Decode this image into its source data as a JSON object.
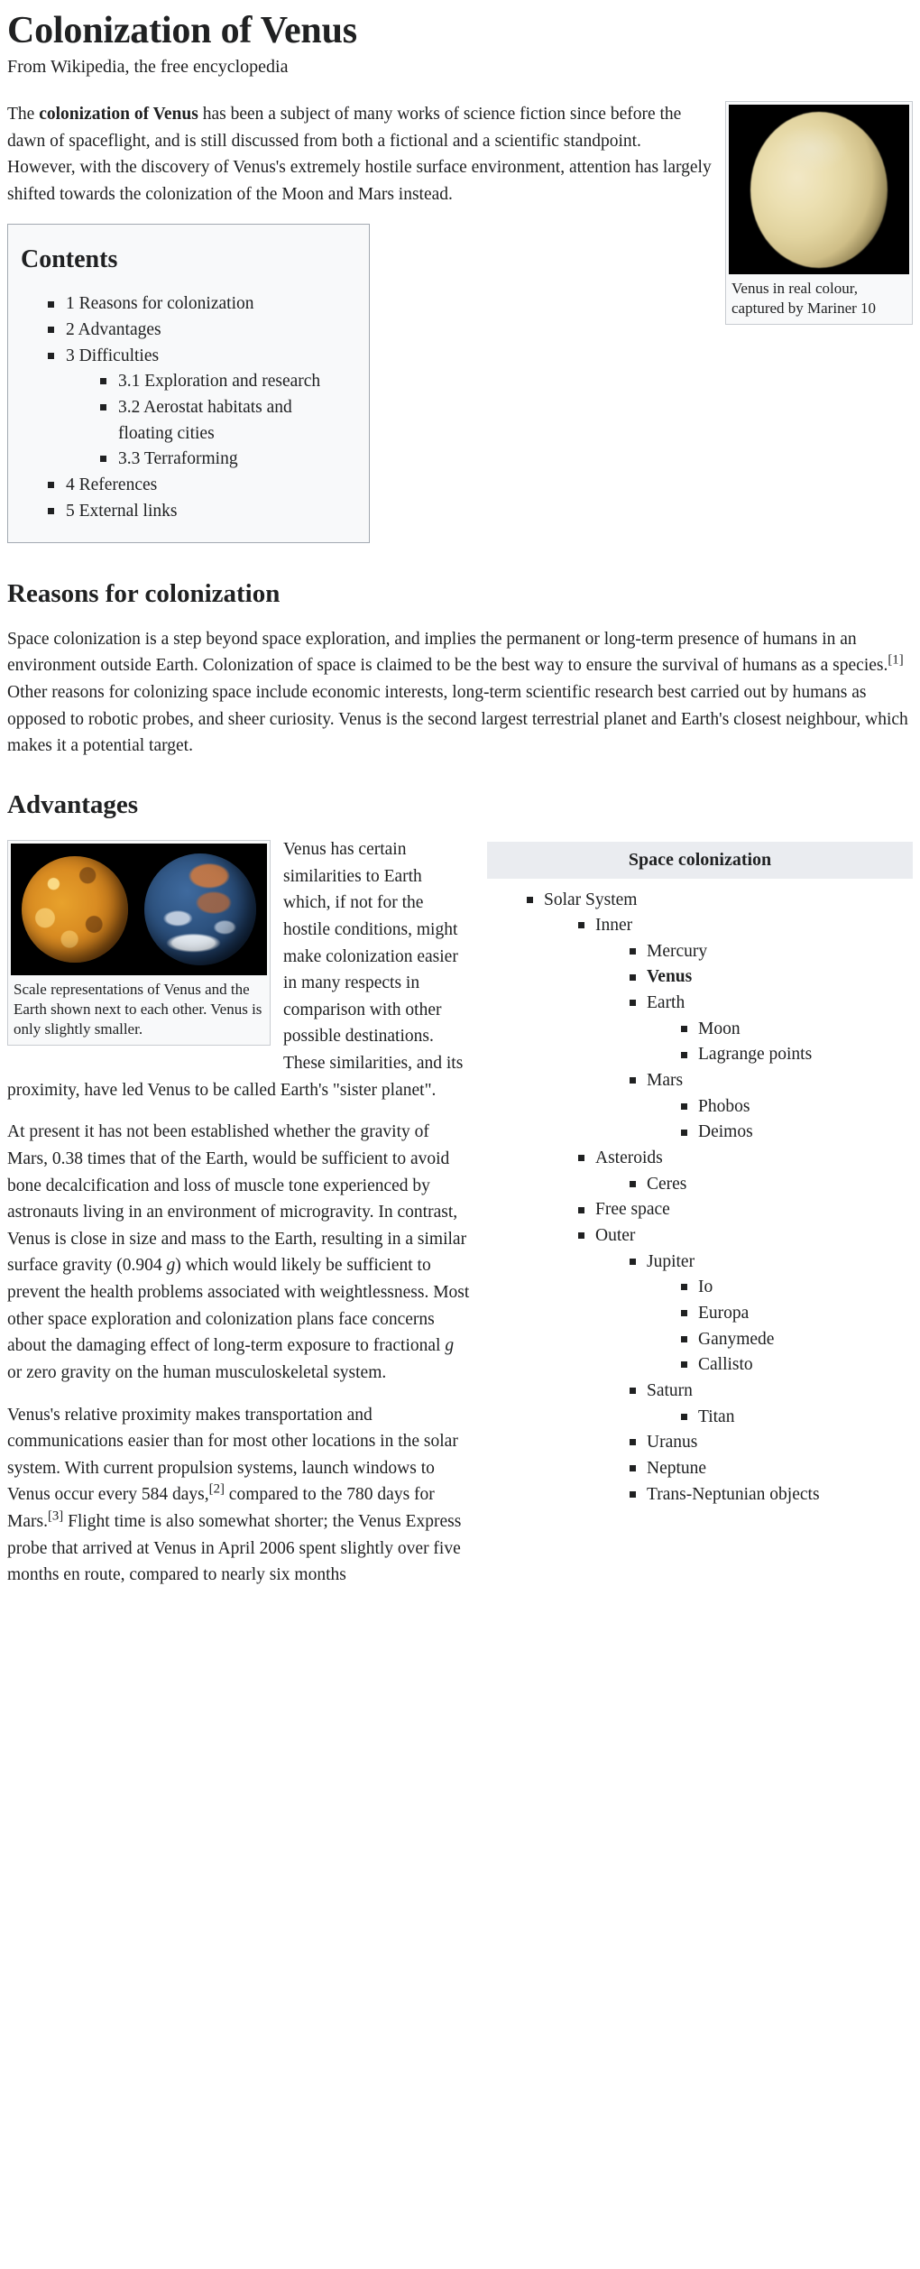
{
  "article": {
    "title": "Colonization of Venus",
    "tagline": "From Wikipedia, the free encyclopedia"
  },
  "lead": {
    "p1_before_bold": "The ",
    "p1_bold": "colonization of Venus",
    "p1_after_bold": " has been a subject of many works of science fiction since before the dawn of spaceflight, and is still discussed from both a fictional and a scientific standpoint. However, with the discovery of Venus's extremely hostile surface environment, attention has largely shifted towards the colonization of the Moon and Mars instead."
  },
  "figures": {
    "venus_real": {
      "caption": "Venus in real colour, captured by Mariner 10",
      "alt": "Venus in real colour",
      "background_color": "#000000",
      "planet_color": "#e2d4a0"
    },
    "venus_earth_scale": {
      "caption": "Scale representations of Venus and the Earth shown next to each other. Venus is only slightly smaller.",
      "alt": "Venus and Earth side by side",
      "background_color": "#000000",
      "venus_color": "#d98c22",
      "earth_color": "#2d527f"
    }
  },
  "toc": {
    "heading": "Contents",
    "items": [
      {
        "label": "1 Reasons for colonization",
        "children": []
      },
      {
        "label": "2 Advantages",
        "children": []
      },
      {
        "label": "3 Difficulties",
        "children": [
          {
            "label": "3.1 Exploration and research"
          },
          {
            "label": "3.2 Aerostat habitats and floating cities"
          },
          {
            "label": "3.3 Terraforming"
          }
        ]
      },
      {
        "label": "4 References",
        "children": []
      },
      {
        "label": "5 External links",
        "children": []
      }
    ]
  },
  "sections": {
    "reasons": {
      "heading": "Reasons for colonization",
      "p1_a": "Space colonization is a step beyond space exploration, and implies the permanent or long-term presence of humans in an environment outside Earth. Colonization of space is claimed to be the best way to ensure the survival of humans as a species.",
      "p1_ref": "[1]",
      "p1_b": " Other reasons for colonizing space include economic interests, long-term scientific research best carried out by humans as opposed to robotic probes, and sheer curiosity. Venus is the second largest terrestrial planet and Earth's closest neighbour, which makes it a potential target."
    },
    "advantages": {
      "heading": "Advantages",
      "p1": "Venus has certain similarities to Earth which, if not for the hostile conditions, might make colonization easier in many respects in comparison with other possible destinations. These similarities, and its proximity, have led Venus to be called Earth's \"sister planet\".",
      "p2_a": "At present it has not been established whether the gravity of Mars, 0.38 times that of the Earth, would be sufficient to avoid bone decalcification and loss of muscle tone experienced by astronauts living in an environment of microgravity. In contrast, Venus is close in size and mass to the Earth, resulting in a similar surface gravity (0.904 ",
      "p2_italic_g": "g",
      "p2_b": ") which would likely be sufficient to prevent the health problems associated with weightlessness. Most other space exploration and colonization plans face concerns about the damaging effect of long-term exposure to fractional ",
      "p2_italic_g2": "g",
      "p2_c": " or zero gravity on the human musculoskeletal system.",
      "p3_a": "Venus's relative proximity makes transportation and communications easier than for most other locations in the solar system. With current propulsion systems, launch windows to Venus occur every 584 days,",
      "p3_ref2": "[2]",
      "p3_b": " compared to the 780 days for Mars.",
      "p3_ref3": "[3]",
      "p3_c": " Flight time is also somewhat shorter; the Venus Express probe that arrived at Venus in April 2006 spent slightly over five months en route, compared to nearly six months"
    }
  },
  "navbox": {
    "title": "Space colonization",
    "items": [
      {
        "label": "Solar System",
        "bold": false,
        "children": [
          {
            "label": "Inner",
            "bold": false,
            "children": [
              {
                "label": "Mercury",
                "bold": false,
                "children": []
              },
              {
                "label": "Venus",
                "bold": true,
                "children": []
              },
              {
                "label": "Earth",
                "bold": false,
                "children": [
                  {
                    "label": "Moon",
                    "bold": false,
                    "children": []
                  },
                  {
                    "label": "Lagrange points",
                    "bold": false,
                    "children": []
                  }
                ]
              },
              {
                "label": "Mars",
                "bold": false,
                "children": [
                  {
                    "label": "Phobos",
                    "bold": false,
                    "children": []
                  },
                  {
                    "label": "Deimos",
                    "bold": false,
                    "children": []
                  }
                ]
              }
            ]
          },
          {
            "label": "Asteroids",
            "bold": false,
            "children": [
              {
                "label": "Ceres",
                "bold": false,
                "children": []
              }
            ]
          },
          {
            "label": "Free space",
            "bold": false,
            "children": []
          },
          {
            "label": "Outer",
            "bold": false,
            "children": [
              {
                "label": "Jupiter",
                "bold": false,
                "children": [
                  {
                    "label": "Io",
                    "bold": false,
                    "children": []
                  },
                  {
                    "label": "Europa",
                    "bold": false,
                    "children": []
                  },
                  {
                    "label": "Ganymede",
                    "bold": false,
                    "children": []
                  },
                  {
                    "label": "Callisto",
                    "bold": false,
                    "children": []
                  }
                ]
              },
              {
                "label": "Saturn",
                "bold": false,
                "children": [
                  {
                    "label": "Titan",
                    "bold": false,
                    "children": []
                  }
                ]
              },
              {
                "label": "Uranus",
                "bold": false,
                "children": []
              },
              {
                "label": "Neptune",
                "bold": false,
                "children": []
              },
              {
                "label": "Trans-Neptunian objects",
                "bold": false,
                "children": []
              }
            ]
          }
        ]
      }
    ]
  }
}
